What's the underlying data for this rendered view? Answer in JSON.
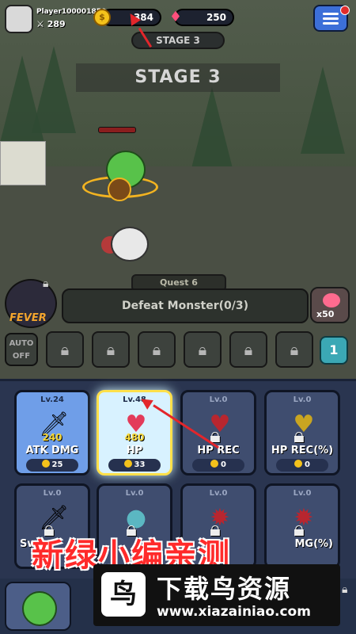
{
  "player": {
    "name": "Player100001850",
    "power": "289"
  },
  "currency": {
    "coins": "384",
    "gems": "250"
  },
  "stage": {
    "pill": "STAGE 3",
    "banner": "STAGE 3"
  },
  "quest": {
    "tab": "Quest 6",
    "text": "Defeat Monster(0/3)",
    "reward": "x50"
  },
  "fever_label": "FEVER",
  "auto_label": "AUTO\nOFF",
  "skill_count": "1",
  "upgrades": [
    {
      "level": "Lv.24",
      "value": "240",
      "name": "ATK DMG",
      "cost": "25",
      "locked": false
    },
    {
      "level": "Lv.48",
      "value": "480",
      "name": "HP",
      "cost": "33",
      "locked": false
    },
    {
      "level": "Lv.0",
      "value": "",
      "name": "HP REC",
      "cost": "0",
      "locked": true
    },
    {
      "level": "Lv.0",
      "value": "",
      "name": "HP REC(%)",
      "cost": "0",
      "locked": true
    },
    {
      "level": "Lv.0",
      "value": "",
      "name": "Sw",
      "cost": "",
      "locked": true
    },
    {
      "level": "Lv.0",
      "value": "",
      "name": "",
      "cost": "",
      "locked": true
    },
    {
      "level": "Lv.0",
      "value": "",
      "name": "",
      "cost": "",
      "locked": true
    },
    {
      "level": "Lv.0",
      "value": "",
      "name": "MG(%)",
      "cost": "",
      "locked": true
    }
  ],
  "overlay_text": "新绿小编亲测",
  "watermark": {
    "title": "下载鸟资源",
    "url": "www.xiazainiao.com"
  },
  "colors": {
    "accent_red": "#e3262b",
    "coin": "#f4c21b",
    "gem": "#ff4f7b",
    "panel": "#2a3550"
  }
}
